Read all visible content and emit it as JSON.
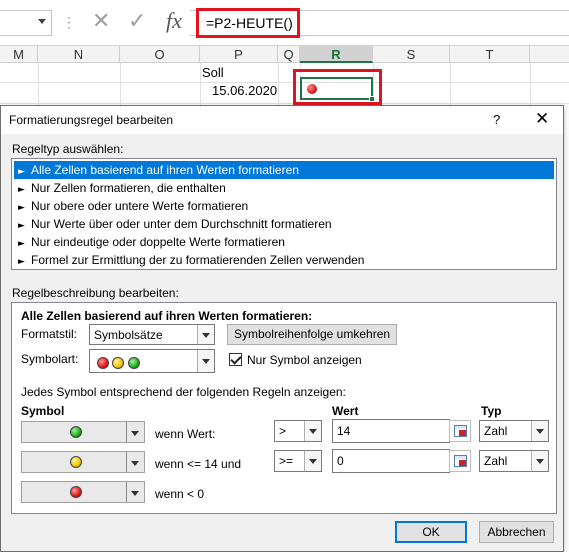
{
  "formula_bar": {
    "separator": "⋮",
    "cancel_glyph": "✕",
    "enter_glyph": "✓",
    "fx_label": "fx",
    "formula": "=P2-HEUTE()"
  },
  "columns": [
    "M",
    "N",
    "O",
    "P",
    "Q",
    "R",
    "S",
    "T"
  ],
  "cells": {
    "p1": "Soll",
    "p2": "15.06.2020"
  },
  "dialog": {
    "title": "Formatierungsregel bearbeiten",
    "help": "?",
    "close": "✕",
    "ruletype_label": "Regeltyp auswählen:",
    "rule_types": [
      "Alle Zellen basierend auf ihren Werten formatieren",
      "Nur Zellen formatieren, die enthalten",
      "Nur obere oder untere Werte formatieren",
      "Nur Werte über oder unter dem Durchschnitt formatieren",
      "Nur eindeutige oder doppelte Werte formatieren",
      "Formel zur Ermittlung der zu formatierenden Zellen verwenden"
    ],
    "rule_arrow": "►",
    "desc_label": "Regelbeschreibung bearbeiten:",
    "desc_heading": "Alle Zellen basierend auf ihren Werten formatieren:",
    "format_style_label": "Formatstil:",
    "format_style_value": "Symbolsätze",
    "reverse_button": "Symbolreihenfolge umkehren",
    "symbol_type_label": "Symbolart:",
    "only_symbol_label": "Nur Symbol anzeigen",
    "only_symbol_checked": true,
    "rules_text": "Jedes Symbol entsprechend der folgenden Regeln anzeigen:",
    "col_symbol": "Symbol",
    "col_value": "Wert",
    "col_type": "Typ",
    "rules": [
      {
        "icon": "green",
        "condition": "wenn Wert:",
        "operator": ">",
        "value": "14",
        "type": "Zahl"
      },
      {
        "icon": "yellow",
        "condition": "wenn <= 14 und",
        "operator": ">=",
        "value": "0",
        "type": "Zahl"
      },
      {
        "icon": "red",
        "condition": "wenn < 0"
      }
    ],
    "ok": "OK",
    "cancel": "Abbrechen"
  },
  "colors": {
    "highlight_red": "#e0131f",
    "selection_blue": "#0078d7",
    "excel_green": "#217346"
  }
}
